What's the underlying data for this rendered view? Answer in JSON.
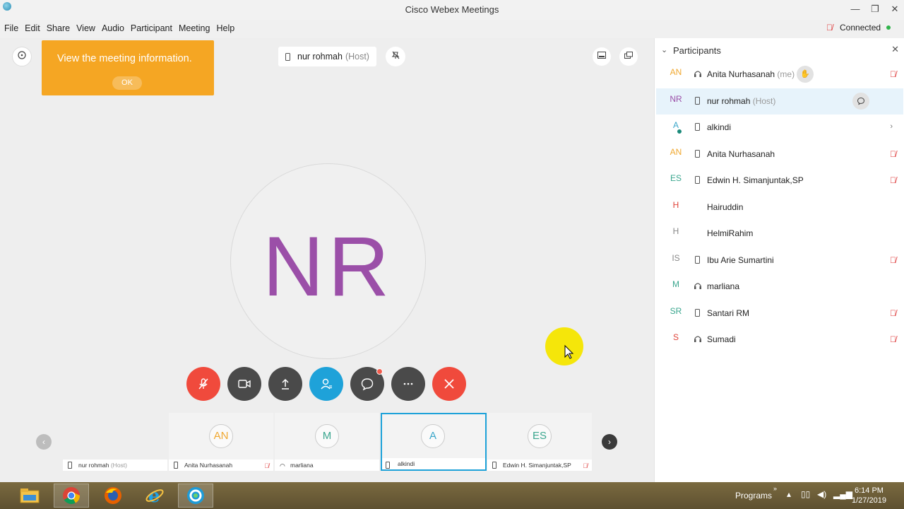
{
  "window": {
    "title": "Cisco Webex Meetings",
    "minimize": "—",
    "maximize": "❐",
    "close": "✕"
  },
  "menu": [
    "File",
    "Edit",
    "Share",
    "View",
    "Audio",
    "Participant",
    "Meeting",
    "Help"
  ],
  "connection": {
    "status": "Connected",
    "status_color": "#2fb34a"
  },
  "tooltip": {
    "text": "View the meeting information.",
    "ok_label": "OK",
    "color": "#f5a623"
  },
  "presenter": {
    "name": "nur rohmah",
    "role": "(Host)",
    "initials": "NR",
    "initials_color": "#9b4fa8"
  },
  "controls": [
    {
      "name": "mute-button",
      "color": "#f04a3c",
      "icon": "mic-muted-icon"
    },
    {
      "name": "video-button",
      "color": "#4a4a4a",
      "icon": "video-icon"
    },
    {
      "name": "share-button",
      "color": "#4a4a4a",
      "icon": "share-icon"
    },
    {
      "name": "participants-button",
      "color": "#1ea2d9",
      "icon": "participants-icon"
    },
    {
      "name": "chat-button",
      "color": "#4a4a4a",
      "icon": "chat-icon"
    },
    {
      "name": "more-button",
      "color": "#4a4a4a",
      "icon": "more-icon"
    },
    {
      "name": "leave-button",
      "color": "#f04a3c",
      "icon": "close-icon"
    }
  ],
  "filmstrip": [
    {
      "initials": "",
      "label": "nur rohmah",
      "sub": "(Host)",
      "muted": false,
      "color": "#333"
    },
    {
      "initials": "AN",
      "label": "Anita Nurhasanah",
      "sub": "",
      "muted": true,
      "color": "#f0a830"
    },
    {
      "initials": "M",
      "label": "marliana",
      "sub": "",
      "muted": false,
      "color": "#3aa68e"
    },
    {
      "initials": "A",
      "label": "alkindi",
      "sub": "",
      "muted": false,
      "color": "#3aa6c9"
    },
    {
      "initials": "ES",
      "label": "Edwin H. Simanjuntak,SP",
      "sub": "",
      "muted": true,
      "color": "#3aa68e"
    }
  ],
  "panel": {
    "title": "Participants",
    "participants": [
      {
        "initials": "AN",
        "color": "#f0a830",
        "name": "Anita Nurhasanah",
        "sub": "(me)",
        "device": "headset",
        "muted": true,
        "action": "raise-hand"
      },
      {
        "initials": "NR",
        "color": "#9b4fa8",
        "name": "nur rohmah",
        "sub": "(Host)",
        "device": "phone",
        "muted": false,
        "action": "chat"
      },
      {
        "initials": "A",
        "color": "#3aa6c9",
        "name": "alkindi",
        "sub": "",
        "device": "phone",
        "muted": false,
        "action": "more"
      },
      {
        "initials": "AN",
        "color": "#f0a830",
        "name": "Anita Nurhasanah",
        "sub": "",
        "device": "phone",
        "muted": true,
        "action": ""
      },
      {
        "initials": "ES",
        "color": "#3aa68e",
        "name": "Edwin H. Simanjuntak,SP",
        "sub": "",
        "device": "phone",
        "muted": true,
        "action": ""
      },
      {
        "initials": "H",
        "color": "#e0443a",
        "name": "Hairuddin",
        "sub": "",
        "device": "none",
        "muted": false,
        "action": ""
      },
      {
        "initials": "H",
        "color": "#888888",
        "name": "HelmiRahim",
        "sub": "",
        "device": "none",
        "muted": false,
        "action": ""
      },
      {
        "initials": "IS",
        "color": "#888888",
        "name": "Ibu Arie Sumartini",
        "sub": "",
        "device": "phone",
        "muted": true,
        "action": ""
      },
      {
        "initials": "M",
        "color": "#3aa68e",
        "name": "marliana",
        "sub": "",
        "device": "headset",
        "muted": false,
        "action": ""
      },
      {
        "initials": "SR",
        "color": "#3aa68e",
        "name": "Santari RM",
        "sub": "",
        "device": "phone",
        "muted": true,
        "action": ""
      },
      {
        "initials": "S",
        "color": "#e0443a",
        "name": "Sumadi",
        "sub": "",
        "device": "headset",
        "muted": true,
        "action": ""
      }
    ]
  },
  "taskbar": {
    "programs": "Programs",
    "time": "6:14 PM",
    "date": "1/27/2019"
  }
}
